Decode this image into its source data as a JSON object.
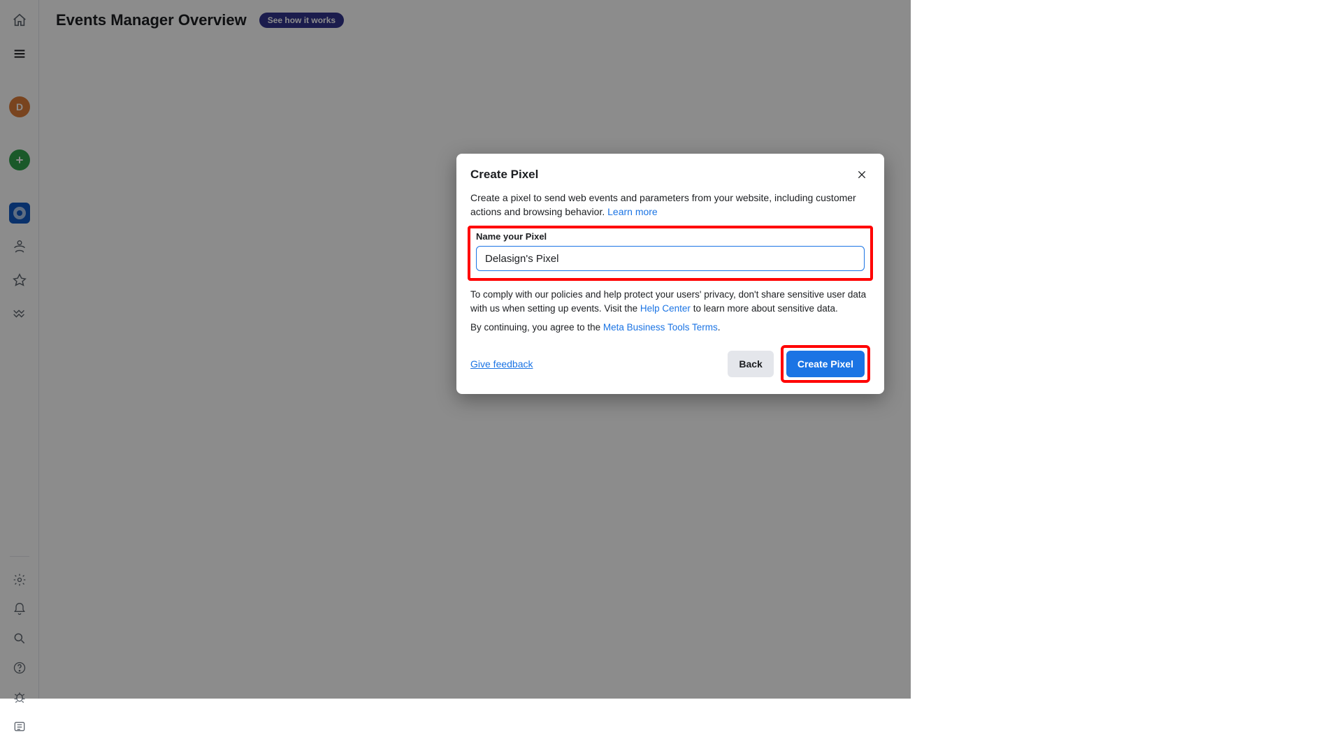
{
  "header": {
    "title": "Events Manager Overview",
    "help_pill": "See how it works"
  },
  "sidebar": {
    "avatar_letter": "D"
  },
  "modal": {
    "title": "Create Pixel",
    "description": "Create a pixel to send web events and parameters from your website, including customer actions and browsing behavior. ",
    "learn_more": "Learn more",
    "field_label": "Name your Pixel",
    "field_value": "Delasign's Pixel",
    "note_pre": "To comply with our policies and help protect your users' privacy, don't share sensitive user data with us when setting up events. Visit the ",
    "help_center": "Help Center",
    "note_post": " to learn more about sensitive data.",
    "agree_pre": "By continuing, you agree to the ",
    "terms_link": "Meta Business Tools Terms",
    "agree_post": ".",
    "feedback": "Give feedback",
    "back": "Back",
    "create": "Create Pixel"
  }
}
